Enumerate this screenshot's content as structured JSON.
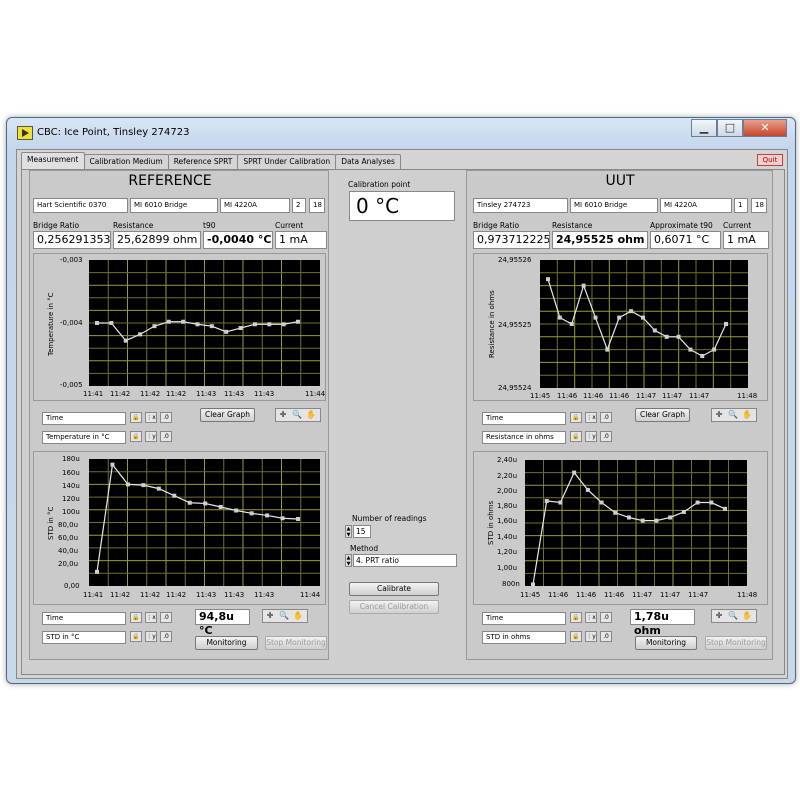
{
  "window": {
    "title": "CBC: Ice Point, Tinsley 274723",
    "min": "▁",
    "max": "□",
    "close": "✕"
  },
  "tabs": [
    "Measurement",
    "Calibration Medium",
    "Reference SPRT",
    "SPRT Under Calibration",
    "Data Analyses"
  ],
  "quit_label": "Quit",
  "reference": {
    "header": "REFERENCE",
    "info": [
      "Hart Scientific 0370",
      "MI 6010 Bridge",
      "MI 4220A",
      "2",
      "18"
    ],
    "labels": {
      "ratio": "Bridge Ratio",
      "resistance": "Resistance",
      "t90": "t90",
      "current": "Current"
    },
    "values": {
      "ratio": "0,256291353",
      "resistance": "25,62899 ohm",
      "t90": "-0,0040 °C",
      "current": "1 mA"
    },
    "graph1": {
      "ylabel": "Temperature in °C",
      "yticks": [
        "-0,003",
        "-0,004",
        "-0,005"
      ],
      "xticks": [
        "11:41",
        "11:42",
        "11:42",
        "11:42",
        "11:43",
        "11:43",
        "11:43",
        "11:44"
      ],
      "legend_x": "Time",
      "legend_y": "Temperature in °C"
    },
    "graph2": {
      "ylabel": "STD in °C",
      "yticks": [
        "180u",
        "160u",
        "140u",
        "120u",
        "100u",
        "80,0u",
        "60,0u",
        "40,0u",
        "20,0u",
        "0,00"
      ],
      "xticks": [
        "11:41",
        "11:42",
        "11:42",
        "11:42",
        "11:43",
        "11:43",
        "11:43",
        "11:44"
      ],
      "legend_x": "Time",
      "legend_y": "STD in °C"
    },
    "clear_graph": "Clear Graph",
    "std_value": "94,8u °C",
    "monitoring": "Monitoring",
    "stop_monitoring": "Stop Monitoring"
  },
  "center": {
    "cal_point_label": "Calibration point",
    "cal_point_value": "0 °C",
    "readings_label": "Number of readings",
    "readings_value": "15",
    "method_label": "Method",
    "method_value": "4. PRT ratio",
    "calibrate": "Calibrate",
    "cancel": "Cancel Calibration"
  },
  "uut": {
    "header": "UUT",
    "info": [
      "Tinsley 274723",
      "MI 6010 Bridge",
      "MI 4220A",
      "1",
      "18"
    ],
    "labels": {
      "ratio": "Bridge Ratio",
      "resistance": "Resistance",
      "t90": "Approximate t90",
      "current": "Current"
    },
    "values": {
      "ratio": "0,973712225",
      "resistance": "24,95525 ohm",
      "t90": "0,6071 °C",
      "current": "1 mA"
    },
    "graph1": {
      "ylabel": "Resistance in ohms",
      "yticks": [
        "24,95526",
        "24,95525",
        "24,95524"
      ],
      "xticks": [
        "11:45",
        "11:46",
        "11:46",
        "11:46",
        "11:47",
        "11:47",
        "11:47",
        "11:48"
      ],
      "legend_x": "Time",
      "legend_y": "Resistance in ohms"
    },
    "graph2": {
      "ylabel": "STD in ohms",
      "yticks": [
        "2,40u",
        "2,20u",
        "2,00u",
        "1,80u",
        "1,60u",
        "1,40u",
        "1,20u",
        "1,00u",
        "800n"
      ],
      "xticks": [
        "11:45",
        "11:46",
        "11:46",
        "11:46",
        "11:47",
        "11:47",
        "11:47",
        "11:48"
      ],
      "legend_x": "Time",
      "legend_y": "STD in ohms"
    },
    "clear_graph": "Clear Graph",
    "std_value": "1,78u ohm",
    "monitoring": "Monitoring",
    "stop_monitoring": "Stop Monitoring"
  },
  "chart_data": [
    {
      "type": "line",
      "ylabel": "Temperature in °C",
      "ylim": [
        -0.005,
        -0.003
      ],
      "y": [
        -0.004,
        -0.004,
        -0.00428,
        -0.00418,
        -0.00405,
        -0.00398,
        -0.00398,
        -0.00402,
        -0.00405,
        -0.00414,
        -0.00408,
        -0.00402,
        -0.00402,
        -0.00402,
        -0.00398
      ],
      "xticks": [
        "11:41",
        "11:42",
        "11:42",
        "11:42",
        "11:43",
        "11:43",
        "11:43",
        "11:44"
      ]
    },
    {
      "type": "line",
      "ylabel": "STD in °C",
      "ylim": [
        0,
        180
      ],
      "y": [
        20,
        172,
        144,
        143,
        138,
        128,
        118,
        117,
        112,
        107,
        103,
        100,
        96,
        95
      ],
      "xticks": [
        "11:41",
        "11:42",
        "11:42",
        "11:42",
        "11:43",
        "11:43",
        "11:43",
        "11:44"
      ]
    },
    {
      "type": "line",
      "ylabel": "Resistance in ohms",
      "ylim": [
        24.95524,
        24.95526
      ],
      "y": [
        24.955257,
        24.955251,
        24.95525,
        24.955256,
        24.955251,
        24.955246,
        24.955251,
        24.955252,
        24.955251,
        24.955249,
        24.955248,
        24.955248,
        24.955246,
        24.955245,
        24.955246,
        24.95525
      ],
      "xticks": [
        "11:45",
        "11:46",
        "11:46",
        "11:46",
        "11:47",
        "11:47",
        "11:47",
        "11:48"
      ]
    },
    {
      "type": "line",
      "ylabel": "STD in ohms",
      "ylim": [
        0.8,
        2.4
      ],
      "y": [
        0.82,
        1.88,
        1.86,
        2.24,
        2.02,
        1.86,
        1.73,
        1.67,
        1.63,
        1.63,
        1.67,
        1.74,
        1.86,
        1.86,
        1.78
      ],
      "xticks": [
        "11:45",
        "11:46",
        "11:46",
        "11:46",
        "11:47",
        "11:47",
        "11:47",
        "11:48"
      ]
    }
  ]
}
